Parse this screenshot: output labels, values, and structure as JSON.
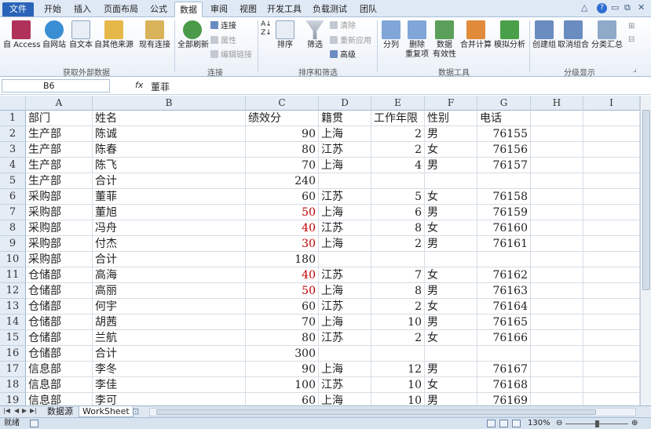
{
  "tabs": [
    "文件",
    "开始",
    "插入",
    "页面布局",
    "公式",
    "数据",
    "审阅",
    "视图",
    "开发工具",
    "负载测试",
    "团队"
  ],
  "active_tab": "数据",
  "ribbon": {
    "groups": [
      {
        "label": "获取外部数据",
        "buttons": [
          "自 Access",
          "自网站",
          "自文本",
          "自其他来源",
          "现有连接"
        ]
      },
      {
        "label": "连接",
        "buttons": [
          "全部刷新"
        ],
        "small": [
          "连接",
          "属性",
          "编辑链接"
        ]
      },
      {
        "label": "排序和筛选",
        "buttons": [
          "排序",
          "筛选"
        ],
        "small": [
          "清除",
          "重新应用",
          "高级"
        ]
      },
      {
        "label": "数据工具",
        "buttons": [
          "分列",
          "删除\n重复项",
          "数据\n有效性",
          "合并计算",
          "模拟分析"
        ]
      },
      {
        "label": "分级显示",
        "buttons": [
          "创建组",
          "取消组合",
          "分类汇总"
        ]
      }
    ]
  },
  "formula_bar": {
    "name_box": "B6",
    "fx": "fx",
    "content": "董菲"
  },
  "columns": [
    "A",
    "B",
    "C",
    "D",
    "E",
    "F",
    "G",
    "H",
    "I"
  ],
  "rows": [
    {
      "n": "1",
      "a": "部门",
      "b": "姓名",
      "c": "绩效分",
      "d": "籍贯",
      "e": "工作年限",
      "f": "性别",
      "g": "电话",
      "c_red": false
    },
    {
      "n": "2",
      "a": "生产部",
      "b": "陈诚",
      "c": "90",
      "d": "上海",
      "e": "2",
      "f": "男",
      "g": "76155",
      "c_red": false
    },
    {
      "n": "3",
      "a": "生产部",
      "b": "陈春",
      "c": "80",
      "d": "江苏",
      "e": "2",
      "f": "女",
      "g": "76156",
      "c_red": false
    },
    {
      "n": "4",
      "a": "生产部",
      "b": "陈飞",
      "c": "70",
      "d": "上海",
      "e": "4",
      "f": "男",
      "g": "76157",
      "c_red": false
    },
    {
      "n": "5",
      "a": "生产部",
      "b": "合计",
      "c": "240",
      "d": "",
      "e": "",
      "f": "",
      "g": "",
      "c_red": false
    },
    {
      "n": "6",
      "a": "采购部",
      "b": "董菲",
      "c": "60",
      "d": "江苏",
      "e": "5",
      "f": "女",
      "g": "76158",
      "c_red": false
    },
    {
      "n": "7",
      "a": "采购部",
      "b": "董旭",
      "c": "50",
      "d": "上海",
      "e": "6",
      "f": "男",
      "g": "76159",
      "c_red": true
    },
    {
      "n": "8",
      "a": "采购部",
      "b": "冯舟",
      "c": "40",
      "d": "江苏",
      "e": "8",
      "f": "女",
      "g": "76160",
      "c_red": true
    },
    {
      "n": "9",
      "a": "采购部",
      "b": "付杰",
      "c": "30",
      "d": "上海",
      "e": "2",
      "f": "男",
      "g": "76161",
      "c_red": true
    },
    {
      "n": "10",
      "a": "采购部",
      "b": "合计",
      "c": "180",
      "d": "",
      "e": "",
      "f": "",
      "g": "",
      "c_red": false
    },
    {
      "n": "11",
      "a": "仓储部",
      "b": "高海",
      "c": "40",
      "d": "江苏",
      "e": "7",
      "f": "女",
      "g": "76162",
      "c_red": true
    },
    {
      "n": "12",
      "a": "仓储部",
      "b": "高丽",
      "c": "50",
      "d": "上海",
      "e": "8",
      "f": "男",
      "g": "76163",
      "c_red": true
    },
    {
      "n": "13",
      "a": "仓储部",
      "b": "何宇",
      "c": "60",
      "d": "江苏",
      "e": "2",
      "f": "女",
      "g": "76164",
      "c_red": false
    },
    {
      "n": "14",
      "a": "仓储部",
      "b": "胡茜",
      "c": "70",
      "d": "上海",
      "e": "10",
      "f": "男",
      "g": "76165",
      "c_red": false
    },
    {
      "n": "15",
      "a": "仓储部",
      "b": "兰航",
      "c": "80",
      "d": "江苏",
      "e": "2",
      "f": "女",
      "g": "76166",
      "c_red": false
    },
    {
      "n": "16",
      "a": "仓储部",
      "b": "合计",
      "c": "300",
      "d": "",
      "e": "",
      "f": "",
      "g": "",
      "c_red": false
    },
    {
      "n": "17",
      "a": "信息部",
      "b": "李冬",
      "c": "90",
      "d": "上海",
      "e": "12",
      "f": "男",
      "g": "76167",
      "c_red": false
    },
    {
      "n": "18",
      "a": "信息部",
      "b": "李佳",
      "c": "100",
      "d": "江苏",
      "e": "10",
      "f": "女",
      "g": "76168",
      "c_red": false
    },
    {
      "n": "19",
      "a": "信息部",
      "b": "李可",
      "c": "60",
      "d": "上海",
      "e": "10",
      "f": "男",
      "g": "76169",
      "c_red": false
    }
  ],
  "sheets": [
    "数据源",
    "WorkSheet"
  ],
  "active_sheet": "WorkSheet",
  "status": {
    "ready": "就绪",
    "zoom": "130%"
  },
  "colors": {
    "file_tab": "#2a64b8",
    "negative_red": "#c00000",
    "header_bg": "#e4ecf6"
  }
}
